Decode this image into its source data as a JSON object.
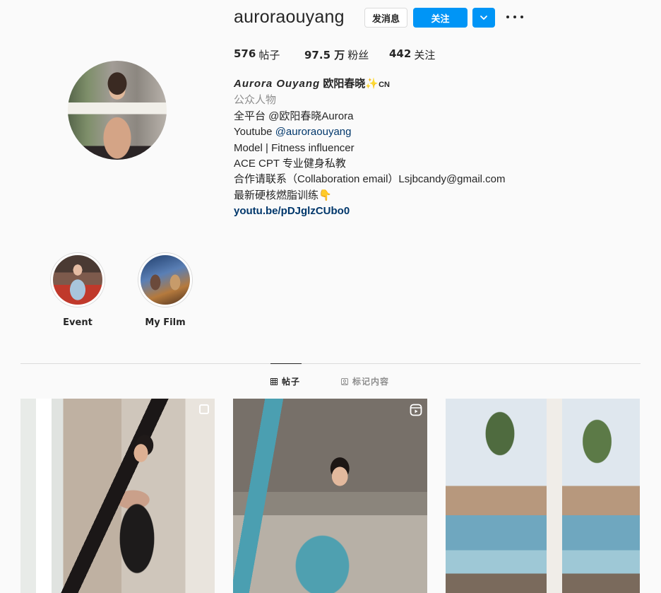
{
  "header": {
    "username": "auroraouyang",
    "message_button": "发消息",
    "follow_button": "关注",
    "dropdown_icon": "chevron-down-icon",
    "more_icon": "more-horizontal-icon"
  },
  "stats": {
    "posts_count": "576",
    "posts_label": "帖子",
    "followers_count": "97.5 万",
    "followers_label": "粉丝",
    "following_count": "442",
    "following_label": "关注"
  },
  "bio": {
    "full_name": "Aurora Ouyang",
    "full_name_cjk": "欧阳春晓",
    "emoji": "✨",
    "country": "CN",
    "category": "公众人物",
    "line1": "全平台 @欧阳春晓Aurora",
    "line2_prefix": "Youtube ",
    "line2_mention": "@auroraouyang",
    "line3": "Model | Fitness influencer",
    "line4": "ACE CPT 专业健身私教",
    "line5": "合作请联系（Collaboration email）Lsjbcandy@gmail.com",
    "line6": "最新硬核燃脂训练👇",
    "link": "youtu.be/pDJglzCUbo0"
  },
  "highlights": [
    {
      "label": "Event"
    },
    {
      "label": "My Film"
    }
  ],
  "tabs": [
    {
      "label": "帖子",
      "icon": "grid-icon",
      "active": true
    },
    {
      "label": "标记内容",
      "icon": "tag-icon",
      "active": false
    }
  ],
  "posts": [
    {
      "badge": "multiple-photos-icon"
    },
    {
      "badge": "reel-icon"
    },
    {
      "badge": ""
    }
  ],
  "colors": {
    "accent": "#0095f6",
    "text": "#262626",
    "muted": "#8e8e8e",
    "link": "#00376b",
    "background": "#fafafa"
  }
}
